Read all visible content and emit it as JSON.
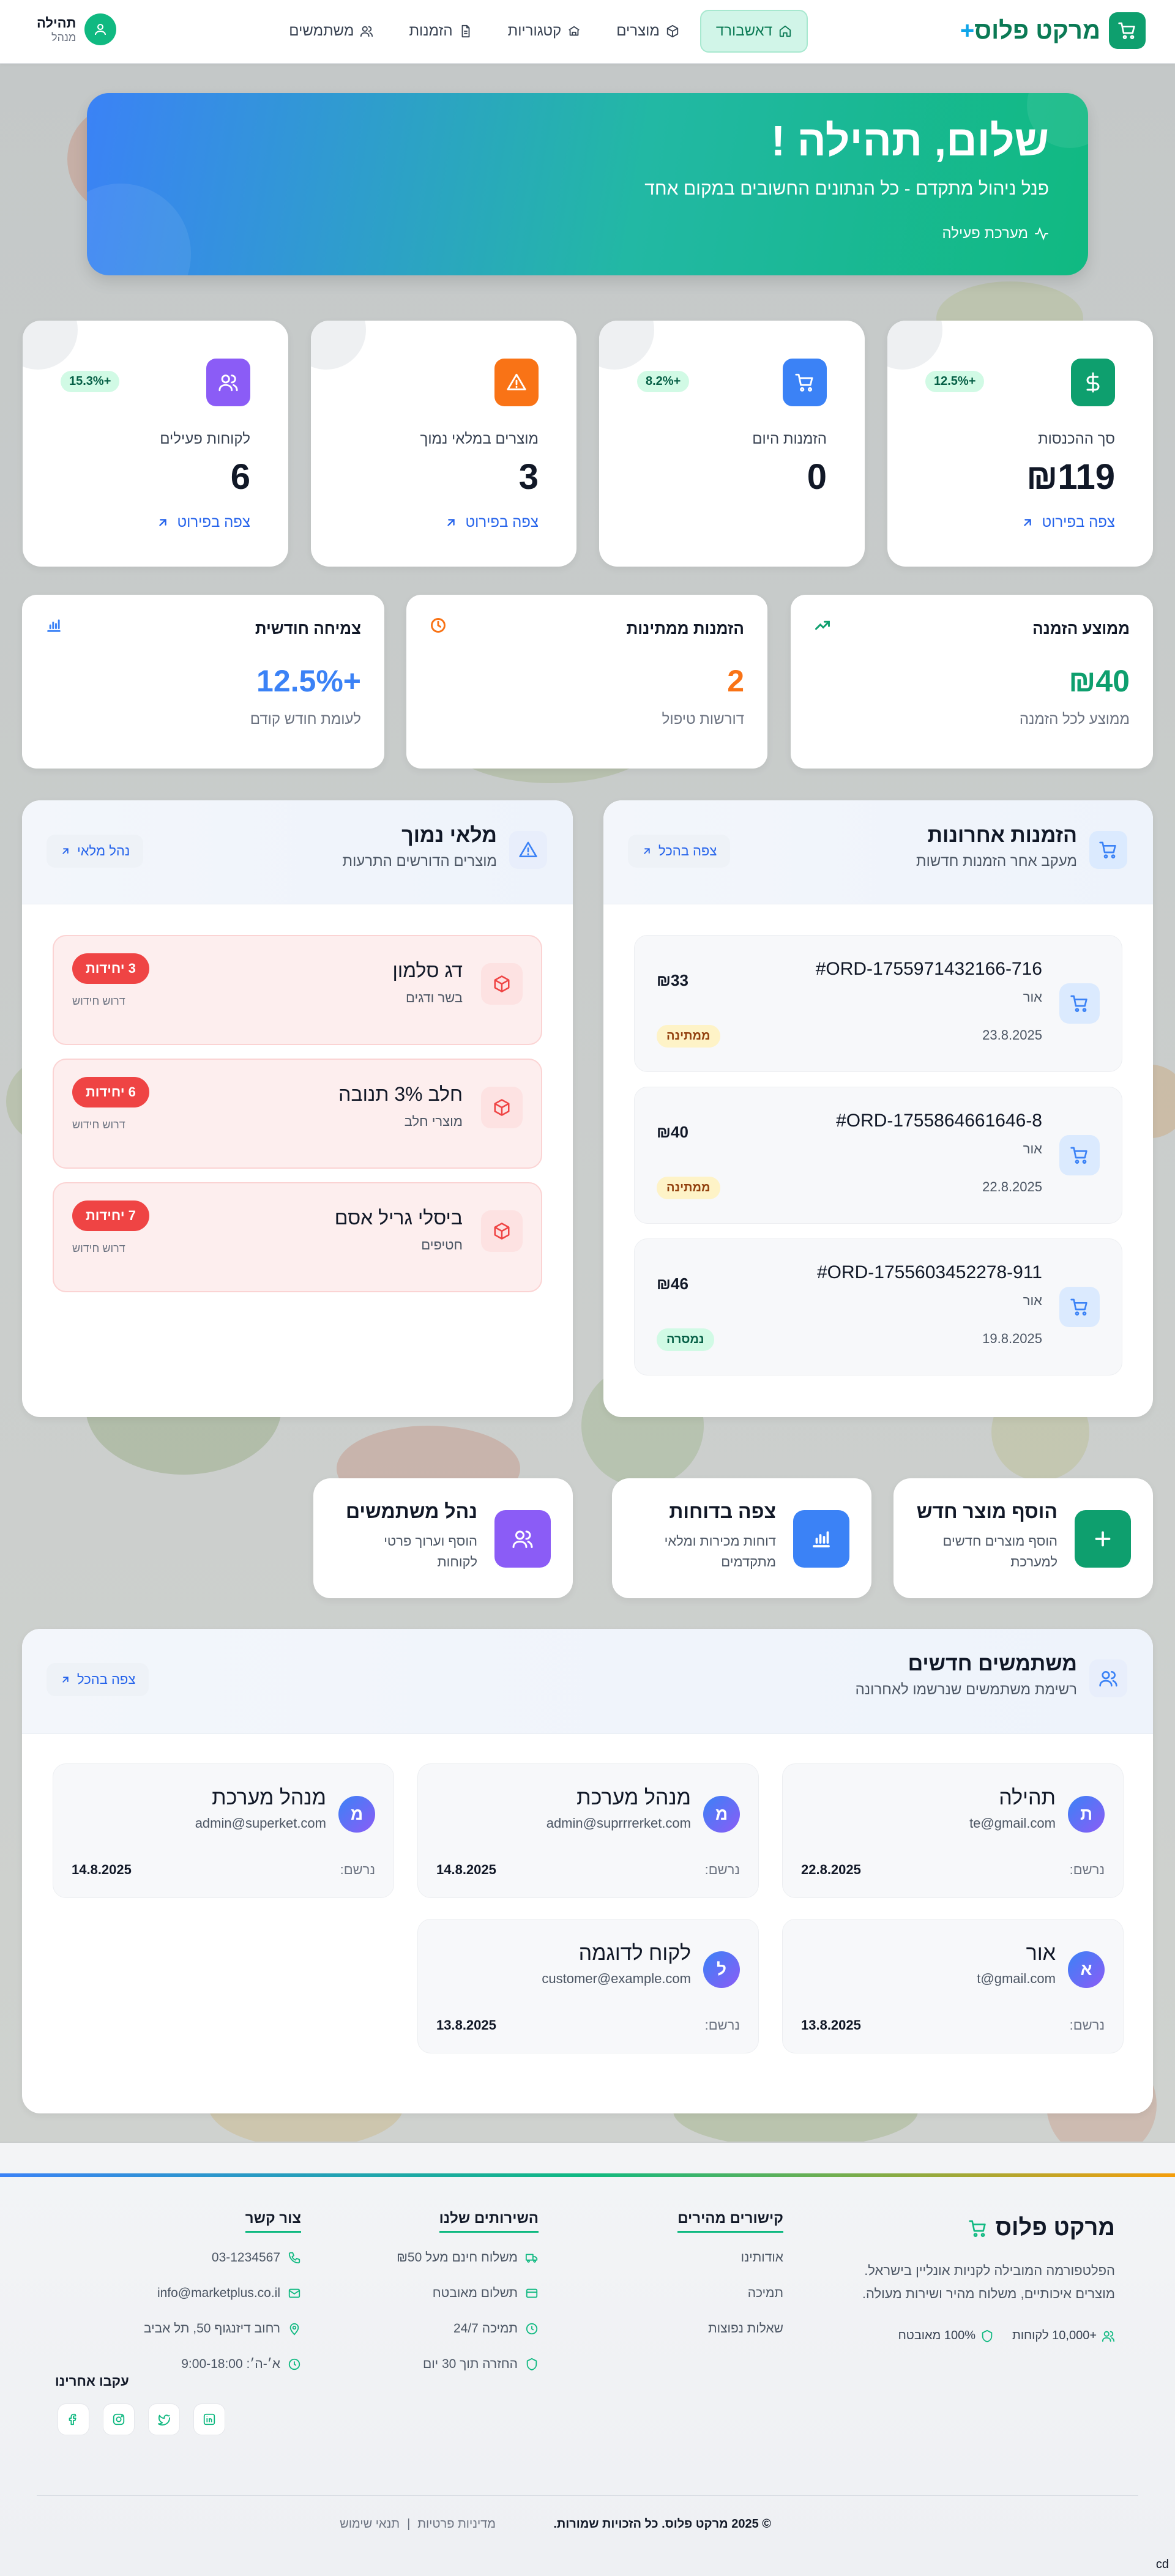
{
  "header": {
    "logo": "מרקט פלוס",
    "logo_plus": "+",
    "nav": [
      {
        "label": "דאשבורד",
        "icon": "home-icon",
        "active": true
      },
      {
        "label": "מוצרים",
        "icon": "box-icon"
      },
      {
        "label": "קטגוריות",
        "icon": "building-icon"
      },
      {
        "label": "הזמנות",
        "icon": "document-icon"
      },
      {
        "label": "משתמשים",
        "icon": "users-icon"
      }
    ],
    "user": {
      "name": "תהילה",
      "role": "מנהל"
    }
  },
  "hero": {
    "title": "שלום, תהילה !",
    "subtitle": "פנל ניהול מתקדם - כל הנתונים החשובים במקום אחד",
    "status": "מערכת פעילה"
  },
  "stats": [
    {
      "label": "סך ההכנסות",
      "value": "₪119",
      "badge": "+12.5%",
      "link": "צפה בפירוט",
      "icon": "dollar-icon",
      "color": "#0e9f6e"
    },
    {
      "label": "הזמנות היום",
      "value": "0",
      "badge": "+8.2%",
      "link": "צפה בפירוט",
      "icon": "cart-icon",
      "color": "#3b82f6"
    },
    {
      "label": "מוצרים במלאי נמוך",
      "value": "3",
      "badge": "",
      "link": "צפה בפירוט",
      "icon": "warning-icon",
      "color": "#f97316"
    },
    {
      "label": "לקוחות פעילים",
      "value": "6",
      "badge": "+15.3%",
      "link": "צפה בפירוט",
      "icon": "users-icon",
      "color": "#8b5cf6"
    }
  ],
  "mini": [
    {
      "title": "ממוצע הזמנה",
      "value": "₪40",
      "note": "ממוצע לכל הזמנה",
      "color": "#0e9f6e",
      "icon": "trend-up-icon"
    },
    {
      "title": "הזמנות ממתינות",
      "value": "2",
      "note": "דורשות טיפול",
      "color": "#f97316",
      "icon": "clock-icon"
    },
    {
      "title": "צמיחה חודשית",
      "value": "+12.5%",
      "note": "לעומת חודש קודם",
      "color": "#3b82f6",
      "icon": "bar-chart-icon"
    }
  ],
  "orders": {
    "title": "הזמנות אחרונות",
    "subtitle": "מעקב אחר הזמנות חדשות",
    "view_all": "צפה בהכל",
    "items": [
      {
        "id": "#ORD-1755971432166-716",
        "customer": "אור",
        "date": "23.8.2025",
        "price": "₪33",
        "status": "ממתינה",
        "status_type": "pending"
      },
      {
        "id": "#ORD-1755864661646-8",
        "customer": "אור",
        "date": "22.8.2025",
        "price": "₪40",
        "status": "ממתינה",
        "status_type": "pending"
      },
      {
        "id": "#ORD-1755603452278-911",
        "customer": "אור",
        "date": "19.8.2025",
        "price": "₪46",
        "status": "נמסרה",
        "status_type": "done"
      }
    ]
  },
  "stock": {
    "title": "מלאי נמוך",
    "subtitle": "מוצרים הדורשים התרעות",
    "manage": "נהל מלאי",
    "items": [
      {
        "name": "דג סלמון",
        "category": "בשר ודגים",
        "units": "3 יחידות",
        "need": "דרוש חידוש"
      },
      {
        "name": "חלב 3% תנובה",
        "category": "מוצרי חלב",
        "units": "6 יחידות",
        "need": "דרוש חידוש"
      },
      {
        "name": "ביסלי גריל אסם",
        "category": "חטיפים",
        "units": "7 יחידות",
        "need": "דרוש חידוש"
      }
    ]
  },
  "actions": [
    {
      "title": "הוסף מוצר חדש",
      "subtitle": "הוסף מוצרים חדשים למערכת",
      "icon": "plus-icon",
      "color": "#0e9f6e"
    },
    {
      "title": "צפה בדוחות",
      "subtitle": "דוחות מכירות ומלאי מתקדמים",
      "icon": "bar-chart-icon",
      "color": "#3b82f6"
    },
    {
      "title": "נהל משתמשים",
      "subtitle": "הוסף וערוך פרטי לקוחות",
      "icon": "users-icon",
      "color": "#8b5cf6"
    }
  ],
  "users": {
    "title": "משתמשים חדשים",
    "subtitle": "רשימת משתמשים שנרשמו לאחרונה",
    "view_all": "צפה בהכל",
    "registered_label": "נרשם:",
    "items": [
      {
        "initial": "ת",
        "name": "תהילה",
        "email": "te@gmail.com",
        "date": "22.8.2025"
      },
      {
        "initial": "מ",
        "name": "מנהל מערכת",
        "email": "admin@suprrrerket.com",
        "date": "14.8.2025"
      },
      {
        "initial": "מ",
        "name": "מנהל מערכת",
        "email": "admin@superket.com",
        "date": "14.8.2025"
      },
      {
        "initial": "א",
        "name": "אור",
        "email": "t@gmail.com",
        "date": "13.8.2025"
      },
      {
        "initial": "ל",
        "name": "לקוח לדוגמה",
        "email": "customer@example.com",
        "date": "13.8.2025"
      }
    ]
  },
  "footer": {
    "brand": "מרקט פלוס",
    "description": "הפלטפורמה המובילה לקניות אונליין בישראל. מוצרים איכותיים, משלוח מהיר ושירות מעולה.",
    "customers": "+10,000 לקוחות",
    "secure": "100% מאובטח",
    "quick_links_title": "קישורים מהירים",
    "quick_links": [
      "אודותינו",
      "תמיכה",
      "שאלות נפוצות"
    ],
    "services_title": "השירותים שלנו",
    "services": [
      "משלוח חינם מעל ₪50",
      "תשלום מאובטח",
      "תמיכה 24/7",
      "החזרה תוך 30 יום"
    ],
    "contact_title": "צור קשר",
    "contact": [
      "03-1234567",
      "info@marketplus.co.il",
      "רחוב דיזנגוף 50, תל אביב",
      "א׳-ה׳: 9:00-18:00"
    ],
    "follow": "עקבו אחרינו",
    "copyright": "© 2025 מרקט פלוס. כל הזכויות שמורות.",
    "privacy": "מדיניות פרטיות",
    "separator": "|",
    "terms": "תנאי שימוש"
  },
  "corner_text": "cd"
}
